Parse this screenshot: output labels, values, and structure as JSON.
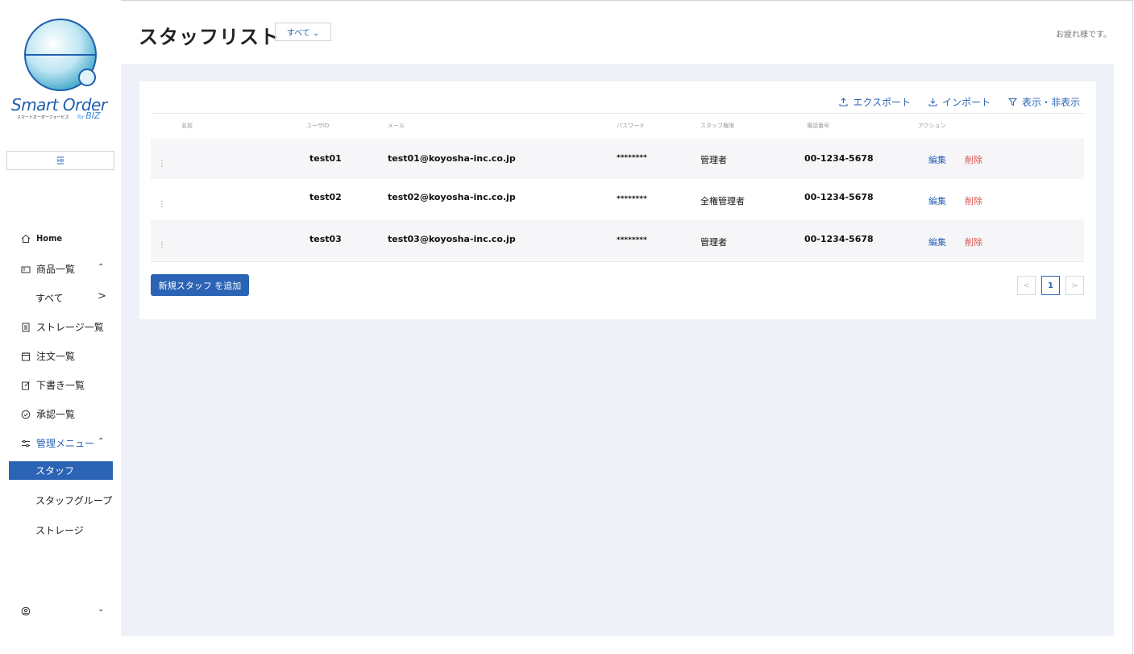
{
  "brand": {
    "logo_title": "Smart Order",
    "logo_sub": "スマートオーダーフォービズ",
    "logo_for": "for",
    "logo_biz": "BIZ"
  },
  "sidebar": {
    "home": "Home",
    "products": "商品一覧",
    "products_all": "すべて",
    "storage_list": "ストレージ一覧",
    "orders": "注文一覧",
    "drafts": "下書き一覧",
    "approvals": "承認一覧",
    "admin_menu": "管理メニュー",
    "staff": "スタッフ",
    "staff_group": "スタッフグループ",
    "storage": "ストレージ"
  },
  "header": {
    "title": "スタッフリスト",
    "filter": "すべて ⌄",
    "greeting": "お疲れ様です。"
  },
  "toolbar": {
    "export": "エクスポート",
    "import": "インポート",
    "toggle_columns": "表示・非表示"
  },
  "table": {
    "headers": {
      "name": "名前",
      "user_id": "ユーザID",
      "email": "メール",
      "password": "パスワード",
      "role": "スタッフ権限",
      "phone": "電話番号",
      "action": "アクション"
    },
    "rows": [
      {
        "user_id": "test01",
        "email": "test01@koyosha-inc.co.jp",
        "password": "********",
        "role": "管理者",
        "phone": "00-1234-5678",
        "edit": "編集",
        "delete": "削除"
      },
      {
        "user_id": "test02",
        "email": "test02@koyosha-inc.co.jp",
        "password": "********",
        "role": "全権管理者",
        "phone": "00-1234-5678",
        "edit": "編集",
        "delete": "削除"
      },
      {
        "user_id": "test03",
        "email": "test03@koyosha-inc.co.jp",
        "password": "********",
        "role": "管理者",
        "phone": "00-1234-5678",
        "edit": "編集",
        "delete": "削除"
      }
    ]
  },
  "actions": {
    "add_staff": "新規スタッフ を追加"
  },
  "pagination": {
    "prev": "<",
    "current": "1",
    "next": ">"
  },
  "colors": {
    "primary": "#2b63b5",
    "danger": "#d9534f",
    "main_bg": "#eef1f7"
  }
}
